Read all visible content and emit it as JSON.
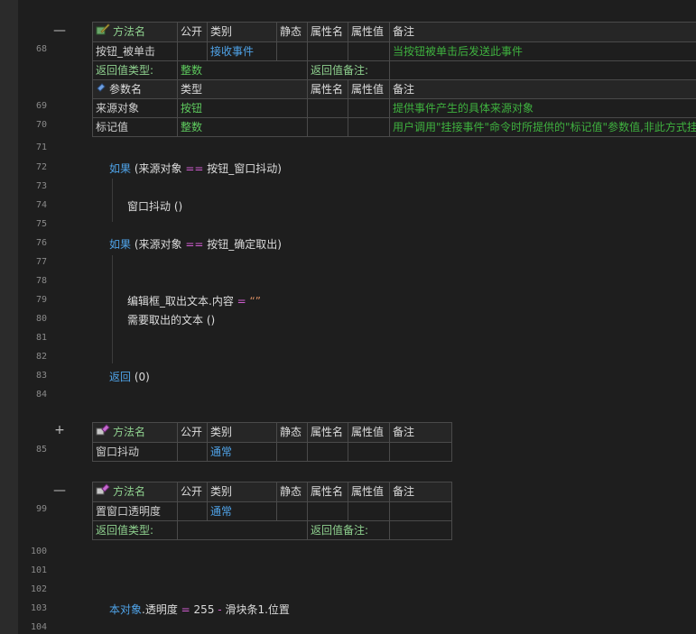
{
  "line_numbers": [
    "68",
    "69",
    "70",
    "71",
    "72",
    "73",
    "74",
    "75",
    "76",
    "77",
    "78",
    "79",
    "80",
    "81",
    "82",
    "83",
    "84",
    "85",
    "99",
    "100",
    "101",
    "102",
    "103",
    "104"
  ],
  "fold_icons": {
    "collapse": "—",
    "expand": "+"
  },
  "hdr": {
    "method": "方法名",
    "public": "公开",
    "type": "类别",
    "static": "静态",
    "attr_name": "属性名",
    "attr_val": "属性值",
    "note": "备注",
    "param": "参数名",
    "ptype": "类型"
  },
  "m1": {
    "name": "按钮_被单击",
    "category": "接收事件",
    "note": "当按钮被单击后发送此事件",
    "ret_type_label": "返回值类型:",
    "ret_type": "整数",
    "ret_note_label": "返回值备注:",
    "params": [
      {
        "name": "来源对象",
        "type": "按钮",
        "note": "提供事件产生的具体来源对象"
      },
      {
        "name": "标记值",
        "type": "整数",
        "note": "用户调用\"挂接事件\"命令时所提供的\"标记值\"参数值,非此方式挂"
      }
    ]
  },
  "code1": {
    "if1_kw": "如果",
    "if1_open": " (来源对象 ",
    "eq": "==",
    "if1_rest": " 按钮_窗口抖动)",
    "call1": "窗口抖动 ()",
    "if2_kw": "如果",
    "if2_open": " (来源对象 ",
    "if2_rest": " 按钮_确定取出)",
    "assign_lhs": "编辑框_取出文本.内容 ",
    "assign_eq": "=",
    "assign_str": " “”",
    "call2": "需要取出的文本 ()",
    "ret_kw": "返回",
    "ret_arg": " (0)"
  },
  "m2": {
    "name": "窗口抖动",
    "category": "通常"
  },
  "m3": {
    "name": "置窗口透明度",
    "category": "通常",
    "ret_type_label": "返回值类型:",
    "ret_note_label": "返回值备注:"
  },
  "code2": {
    "obj": "本对象",
    "dot": ".",
    "prop": "透明度 ",
    "eq": "=",
    "num": " 255 ",
    "minus": "-",
    "rest": " 滑块条1.位置"
  }
}
